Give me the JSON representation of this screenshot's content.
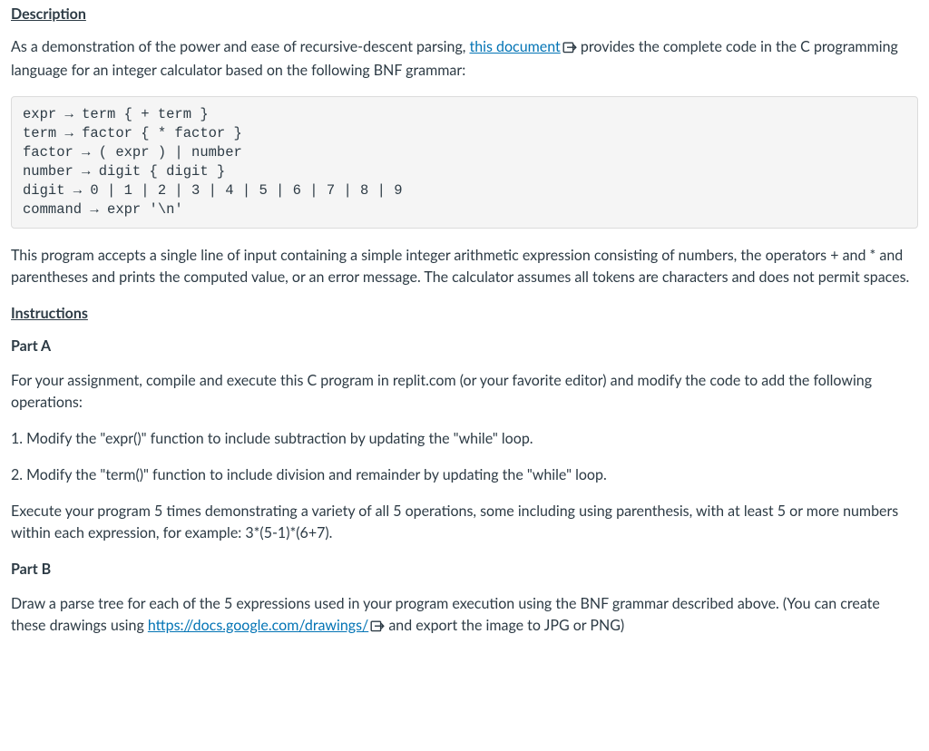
{
  "headings": {
    "description": "Description",
    "instructions": "Instructions"
  },
  "intro": {
    "before_link": "As a demonstration of the power and ease of recursive-descent parsing, ",
    "link_text": "this document",
    "after_link": " provides the complete code in the C programming language for an integer calculator based on the following BNF grammar:"
  },
  "code_block": "expr → term { + term }\nterm → factor { * factor }\nfactor → ( expr ) | number\nnumber → digit { digit }\ndigit → 0 | 1 | 2 | 3 | 4 | 5 | 6 | 7 | 8 | 9\ncommand → expr '\\n'",
  "post_code_paragraph": "This program accepts a single line of input containing a simple integer arithmetic expression consisting of numbers, the operators + and * and parentheses and prints the computed value, or an error message. The calculator assumes all tokens are characters and does not permit spaces.",
  "part_a": {
    "label": "Part A",
    "intro": "For your assignment, compile and execute this C program in replit.com (or your favorite editor) and modify the code to add the following operations:",
    "item1": "1. Modify the \"expr()\" function to include subtraction by updating the \"while\" loop.",
    "item2": "2. Modify the \"term()\" function to include division and remainder by updating the \"while\" loop.",
    "exec": "Execute your program 5 times demonstrating a variety of all 5 operations, some including using parenthesis, with at least 5 or more numbers within each expression, for example: 3*(5-1)*(6+7)."
  },
  "part_b": {
    "label": "Part B",
    "before_link": "Draw a parse tree for each of the 5 expressions used in your program execution using the BNF grammar described above. (You can create these drawings using ",
    "link_text": "https://docs.google.com/drawings/",
    "after_link": " and export the image to JPG or PNG)"
  }
}
